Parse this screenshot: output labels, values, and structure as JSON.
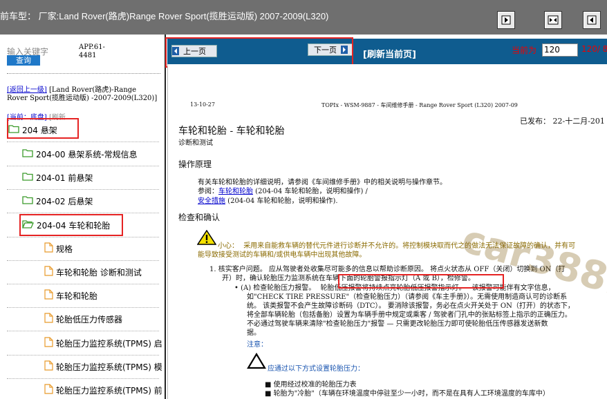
{
  "topbar": {
    "title": "前车型： 厂家:Land Rover(路虎)Range Rover Sport(揽胜运动版) 2007-2009(L320)"
  },
  "sidebar": {
    "keyword_placeholder": "输入关键字",
    "query_label": "查询",
    "app_code": "APP.61-4481",
    "back_label": "[返回上一级]",
    "back_path": "[Land Rover(路虎)-Range Rover Sport(揽胜运动版) -2007-2009(L320)]",
    "current_label": "[当前：",
    "bottom_label": "底盘]",
    "refresh_label": "[刷新",
    "tree": [
      {
        "label": "204 悬架",
        "type": "folder"
      },
      {
        "label": "204-00 悬架系统-常规信息",
        "type": "folder"
      },
      {
        "label": "204-01 前悬架",
        "type": "folder"
      },
      {
        "label": "204-02 后悬架",
        "type": "folder"
      },
      {
        "label": "204-04 车轮和轮胎",
        "type": "folder-open"
      },
      {
        "label": "规格",
        "type": "doc"
      },
      {
        "label": "车轮和轮胎 诊断和测试",
        "type": "doc"
      },
      {
        "label": "车轮和轮胎",
        "type": "doc"
      },
      {
        "label": "轮胎低压力传感器",
        "type": "doc"
      },
      {
        "label": "轮胎压力监控系统(TPMS) 启",
        "type": "doc"
      },
      {
        "label": "轮胎压力监控系统(TPMS) 模",
        "type": "doc"
      },
      {
        "label": "轮胎压力监控系统(TPMS) 前",
        "type": "doc"
      }
    ]
  },
  "nav": {
    "prev_label": "上一页",
    "next_label": "下一页",
    "refresh_label": "[刷新当前页]",
    "current_page_label": "当前为",
    "page_value": "120",
    "page_total": "120/ 84"
  },
  "doc": {
    "date": "13-10-27",
    "header": "TOPIx - WSM-9887 - 车间维修手册 - Range Rover Sport (L320) 2007-09",
    "published": "已发布：  22-十二月-201",
    "title": "车轮和轮胎 - 车轮和轮胎",
    "subtitle": "诊断和测试",
    "section1": "操作原理",
    "p1": "有关车轮和轮胎的详细说明，请参阅《车间维修手册》中的相关说明与操作章节。",
    "p2a": "参阅：",
    "p2_link": "车轮和轮胎",
    "p2b": " (204-04 车轮和轮胎，说明和操作) /",
    "p3_link": "安全措施",
    "p3b": " (204-04 车轮和轮胎，说明和操作).",
    "section2": "检查和确认",
    "caution_label": "小心：",
    "caution_text": "采用来自能救车辆的替代元件进行诊断并不允许的。将控制模块取而代之的做法无法保证故障的确认，并有可",
    "caution_text2": "能导致接受测试的车辆和/或供电车辆中出现其他故障。",
    "step1": "1.  核实客户问题。 应从驾驶者处收集尽可能多的信息以帮助诊断原因。 将点火状态从 OFF（关闭）切换到 ON（打",
    "step1b": "开）时，确认轮胎压力监测系统在车辆下面的轮胎警报指示灯（A 或 B），检修警。",
    "bullet1": "(A) 检查轮胎压力报警。",
    "bullet1_box": "轮胎低压报警将持续点亮轮胎低压报警指示灯。",
    "bullet1_tail": "该报警可能伴有文字信息，",
    "b1l2": "如\"CHECK TIRE PRESSURE\"（检查轮胎压力）（请参阅《车主手册》）。无需使用制造商认可的诊断系",
    "b1l3": "统。 该类报警不会产生故障诊断码（DTC）。 要消除该报警，务必在点火开关处于 ON（打开）的状态下，",
    "b1l4": "将全部车辆轮胎（包括备胎）设置为车辆手册中规定或乘客 / 驾驶者门孔中的张贴标签上指示的正确压力。",
    "b1l5": "不必通过驾驶车辆来清除\"检查轮胎压力\"报警 — 只需更改轮胎压力即可使轮胎低压传感器发送新数",
    "b1l6": "据。",
    "note": "注意：",
    "tri_text": "应通过以下方式设置轮胎压力：",
    "sub1": "使用经过校准的轮胎压力表",
    "sub2": "轮胎为\"冷胎\"（车辆在环境温度中停驻至少一小时，而不是在具有人工环境温度的车库中）",
    "watermark": "car388.com"
  }
}
